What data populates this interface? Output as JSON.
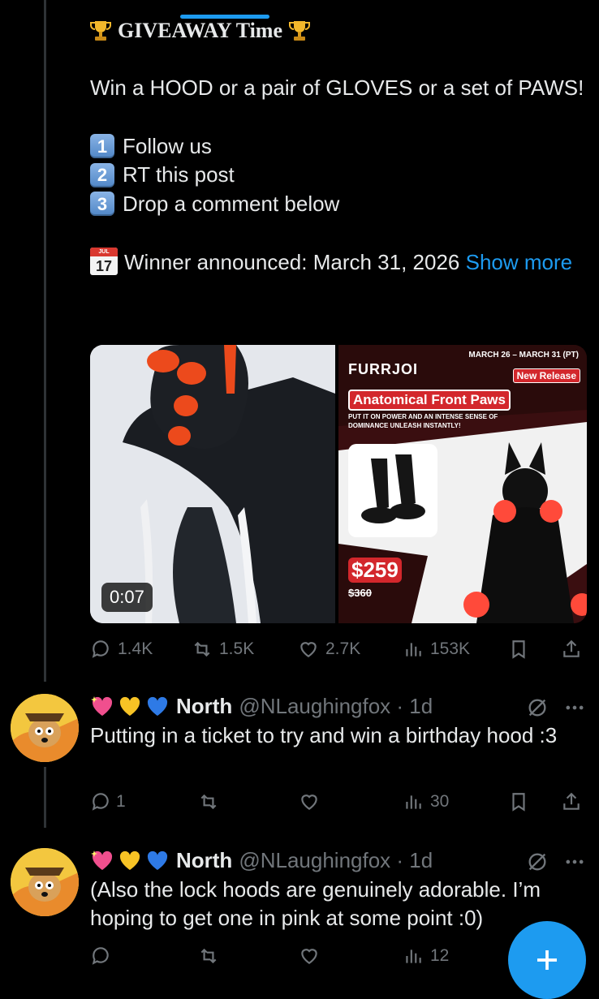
{
  "post": {
    "title": "GIVEAWAY Time",
    "para1": "Win a HOOD or a pair of GLOVES or a set of PAWS!",
    "steps": [
      {
        "key": "1",
        "text": "Follow us"
      },
      {
        "key": "2",
        "text": "RT this post"
      },
      {
        "key": "3",
        "text": "Drop a comment below"
      }
    ],
    "calendar": {
      "month": "JUL",
      "day": "17"
    },
    "winner_text": "Winner announced: March 31, 2026",
    "show_more": "Show more"
  },
  "media": {
    "video_duration": "0:07",
    "ad": {
      "dates": "MARCH 26 – MARCH 31 (PT)",
      "brand": "FURRJOI",
      "badge": "New Release",
      "title": "Anatomical Front Paws",
      "tagline": "PUT IT ON POWER AND AN INTENSE SENSE OF DOMINANCE UNLEASH INSTANTLY!",
      "price": "$259",
      "old_price": "$360"
    }
  },
  "post_actions": {
    "replies": "1.4K",
    "reposts": "1.5K",
    "likes": "2.7K",
    "views": "153K"
  },
  "replies": [
    {
      "name": "North",
      "handle": "@NLaughingfox · 1d",
      "text": "Putting in a ticket to try and win a birthday hood :3",
      "replies": "1",
      "reposts": "",
      "likes": "",
      "views": "30"
    },
    {
      "name": "North",
      "handle": "@NLaughingfox · 1d",
      "text": "(Also the lock hoods are genuinely adorable. I’m hoping to get one in pink at some point :0)",
      "replies": "",
      "reposts": "",
      "likes": "",
      "views": "12"
    }
  ],
  "colors": {
    "accent": "#1d9bf0",
    "muted": "#71767b",
    "background": "#000000"
  }
}
